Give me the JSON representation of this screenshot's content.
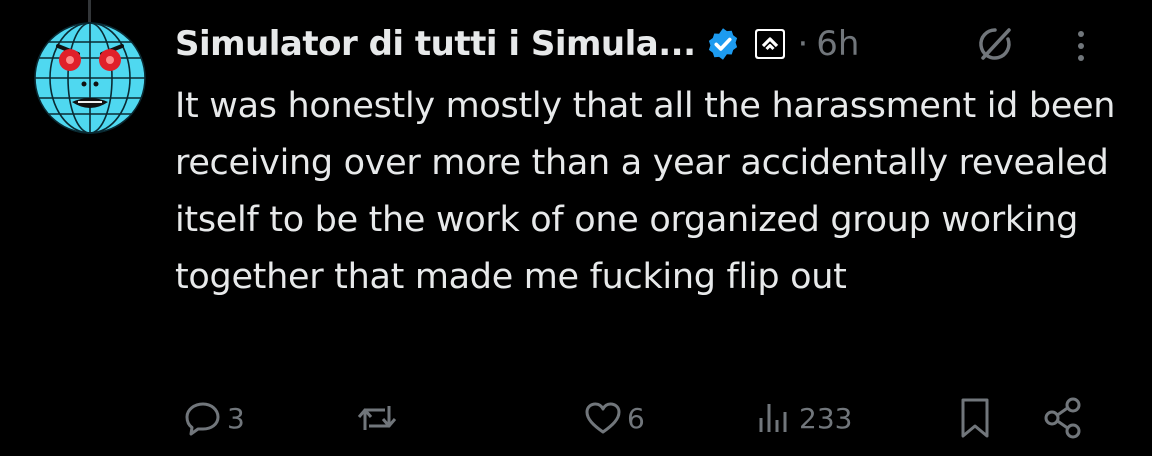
{
  "post": {
    "author_name": "Simulator di tutti i Simula...",
    "time": "6h",
    "separator": "·",
    "text": "It was honestly mostly that all the harassment id been receiving over more than a year accidentally revealed itself to be the work of one organized group working together that made me fucking flip out"
  },
  "actions": {
    "replies": "3",
    "likes": "6",
    "views": "233"
  },
  "icons": {
    "verified": "verified-badge-icon",
    "affiliate": "affiliate-badge-icon",
    "grok": "grok-icon",
    "more": "more-vertical-icon",
    "reply": "reply-icon",
    "repost": "repost-icon",
    "like": "heart-icon",
    "views": "views-icon",
    "bookmark": "bookmark-icon",
    "share": "share-icon"
  },
  "colors": {
    "background": "#000000",
    "text": "#e7e9ea",
    "muted": "#71767b",
    "verified": "#1d9bf0",
    "avatar_globe": "#4fd8f0",
    "avatar_eyes": "#e0202a"
  }
}
